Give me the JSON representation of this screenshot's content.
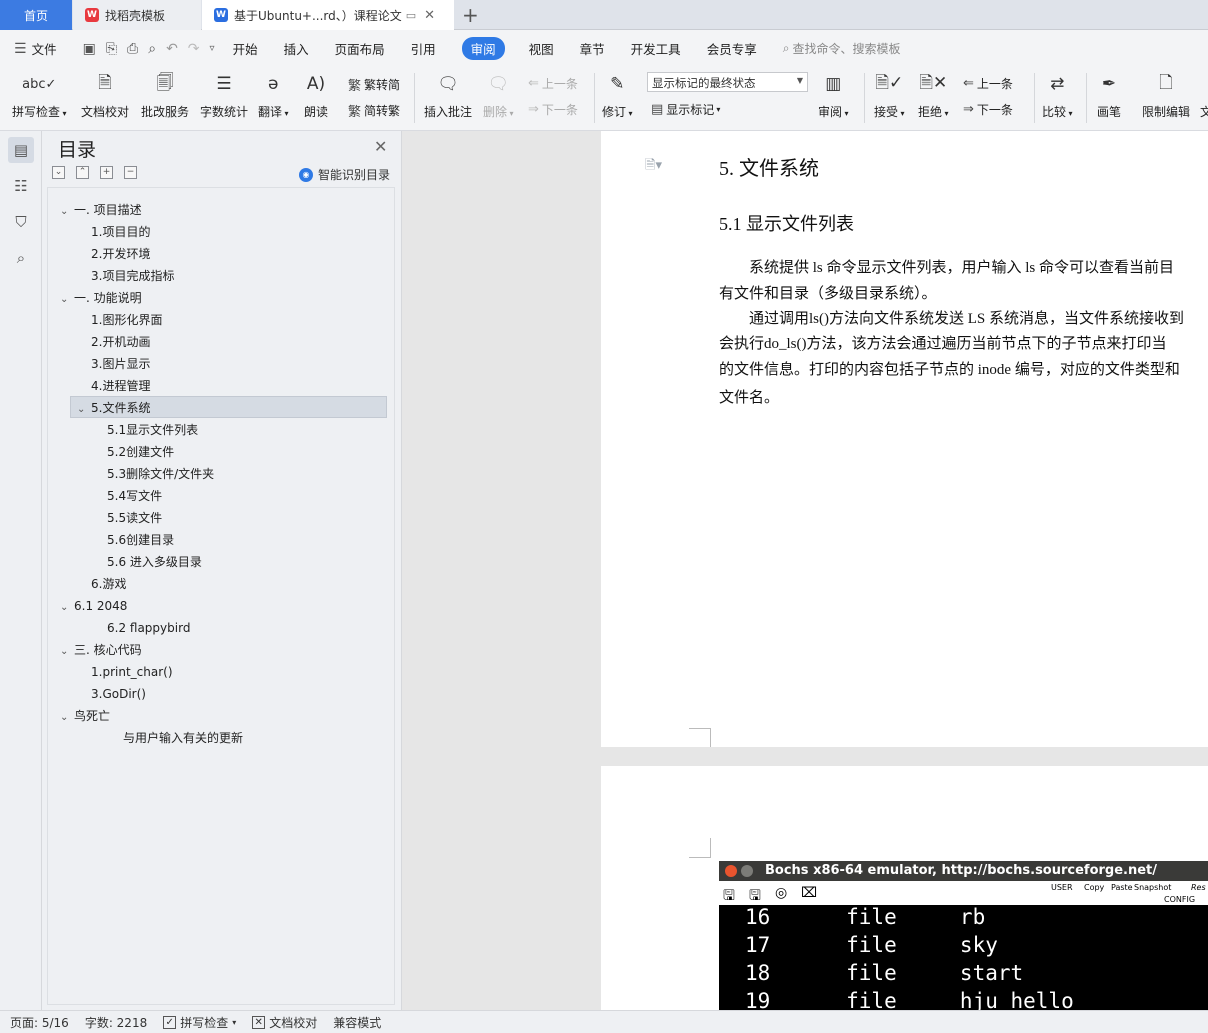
{
  "tabs": {
    "home": "首页",
    "template": "找稻壳模板",
    "doc": "基于Ubuntu+...rd、）课程论文",
    "add": "+"
  },
  "menu": {
    "file": "文件",
    "items": [
      "开始",
      "插入",
      "页面布局",
      "引用",
      "审阅",
      "视图",
      "章节",
      "开发工具",
      "会员专享"
    ],
    "search": "查找命令、搜索模板"
  },
  "ribbon": {
    "spellcheck": "拼写检查",
    "doc_proof": "文档校对",
    "revise_service": "批改服务",
    "word_count": "字数统计",
    "translate": "翻译",
    "read_aloud": "朗读",
    "trad_to_simp": "繁转简",
    "simp_to_trad": "简转繁",
    "insert_comment": "插入批注",
    "delete": "删除",
    "prev": "上一条",
    "next": "下一条",
    "track": "修订",
    "markup_state": "显示标记的最终状态",
    "show_markup": "显示标记",
    "review": "审阅",
    "accept": "接受",
    "reject": "拒绝",
    "prev2": "上一条",
    "next2": "下一条",
    "compare": "比较",
    "pen": "画笔",
    "restrict_edit": "限制编辑",
    "cut_off": "文"
  },
  "toc": {
    "title": "目录",
    "smart": "智能识别目录",
    "items": [
      "一. 项目描述",
      "1.项目目的",
      "2.开发环境",
      "3.项目完成指标",
      "一. 功能说明",
      "1.图形化界面",
      "2.开机动画",
      "3.图片显示",
      "4.进程管理",
      "5.文件系统",
      "5.1显示文件列表",
      "5.2创建文件",
      "5.3删除文件/文件夹",
      "5.4写文件",
      "5.5读文件",
      "5.6创建目录",
      "5.6 进入多级目录",
      "6.游戏",
      "6.1 2048",
      "6.2 flappybird",
      "三. 核心代码",
      "1.print_char()",
      "3.GoDir()",
      "鸟死亡",
      "与用户输入有关的更新"
    ]
  },
  "document": {
    "h1": "5.  文件系统",
    "h2": "5.1  显示文件列表",
    "lines": [
      "　　系统提供 ls 命令显示文件列表，用户输入 ls 命令可以查看当前目",
      "有文件和目录（多级目录系统）。",
      "　　通过调用ls()方法向文件系统发送 LS 系统消息，当文件系统接收到",
      "会执行do_ls()方法，该方法会通过遍历当前节点下的子节点来打印当",
      "的文件信息。打印的内容包括子节点的 inode 编号，对应的文件类型和",
      "文件名。"
    ]
  },
  "bochs": {
    "title": "Bochs x86-64 emulator, http://bochs.sourceforge.net/",
    "toolbar": [
      "USER",
      "Copy",
      "Paste",
      "Snapshot",
      "CONFIG",
      "Res"
    ],
    "rows": [
      "16      file     rb",
      "17      file     sky",
      "18      file     start",
      "19      file     hju hello"
    ]
  },
  "status": {
    "page": "页面: 5/16",
    "words": "字数: 2218",
    "spell": "拼写检查",
    "proof": "文档校对",
    "compat": "兼容模式"
  }
}
